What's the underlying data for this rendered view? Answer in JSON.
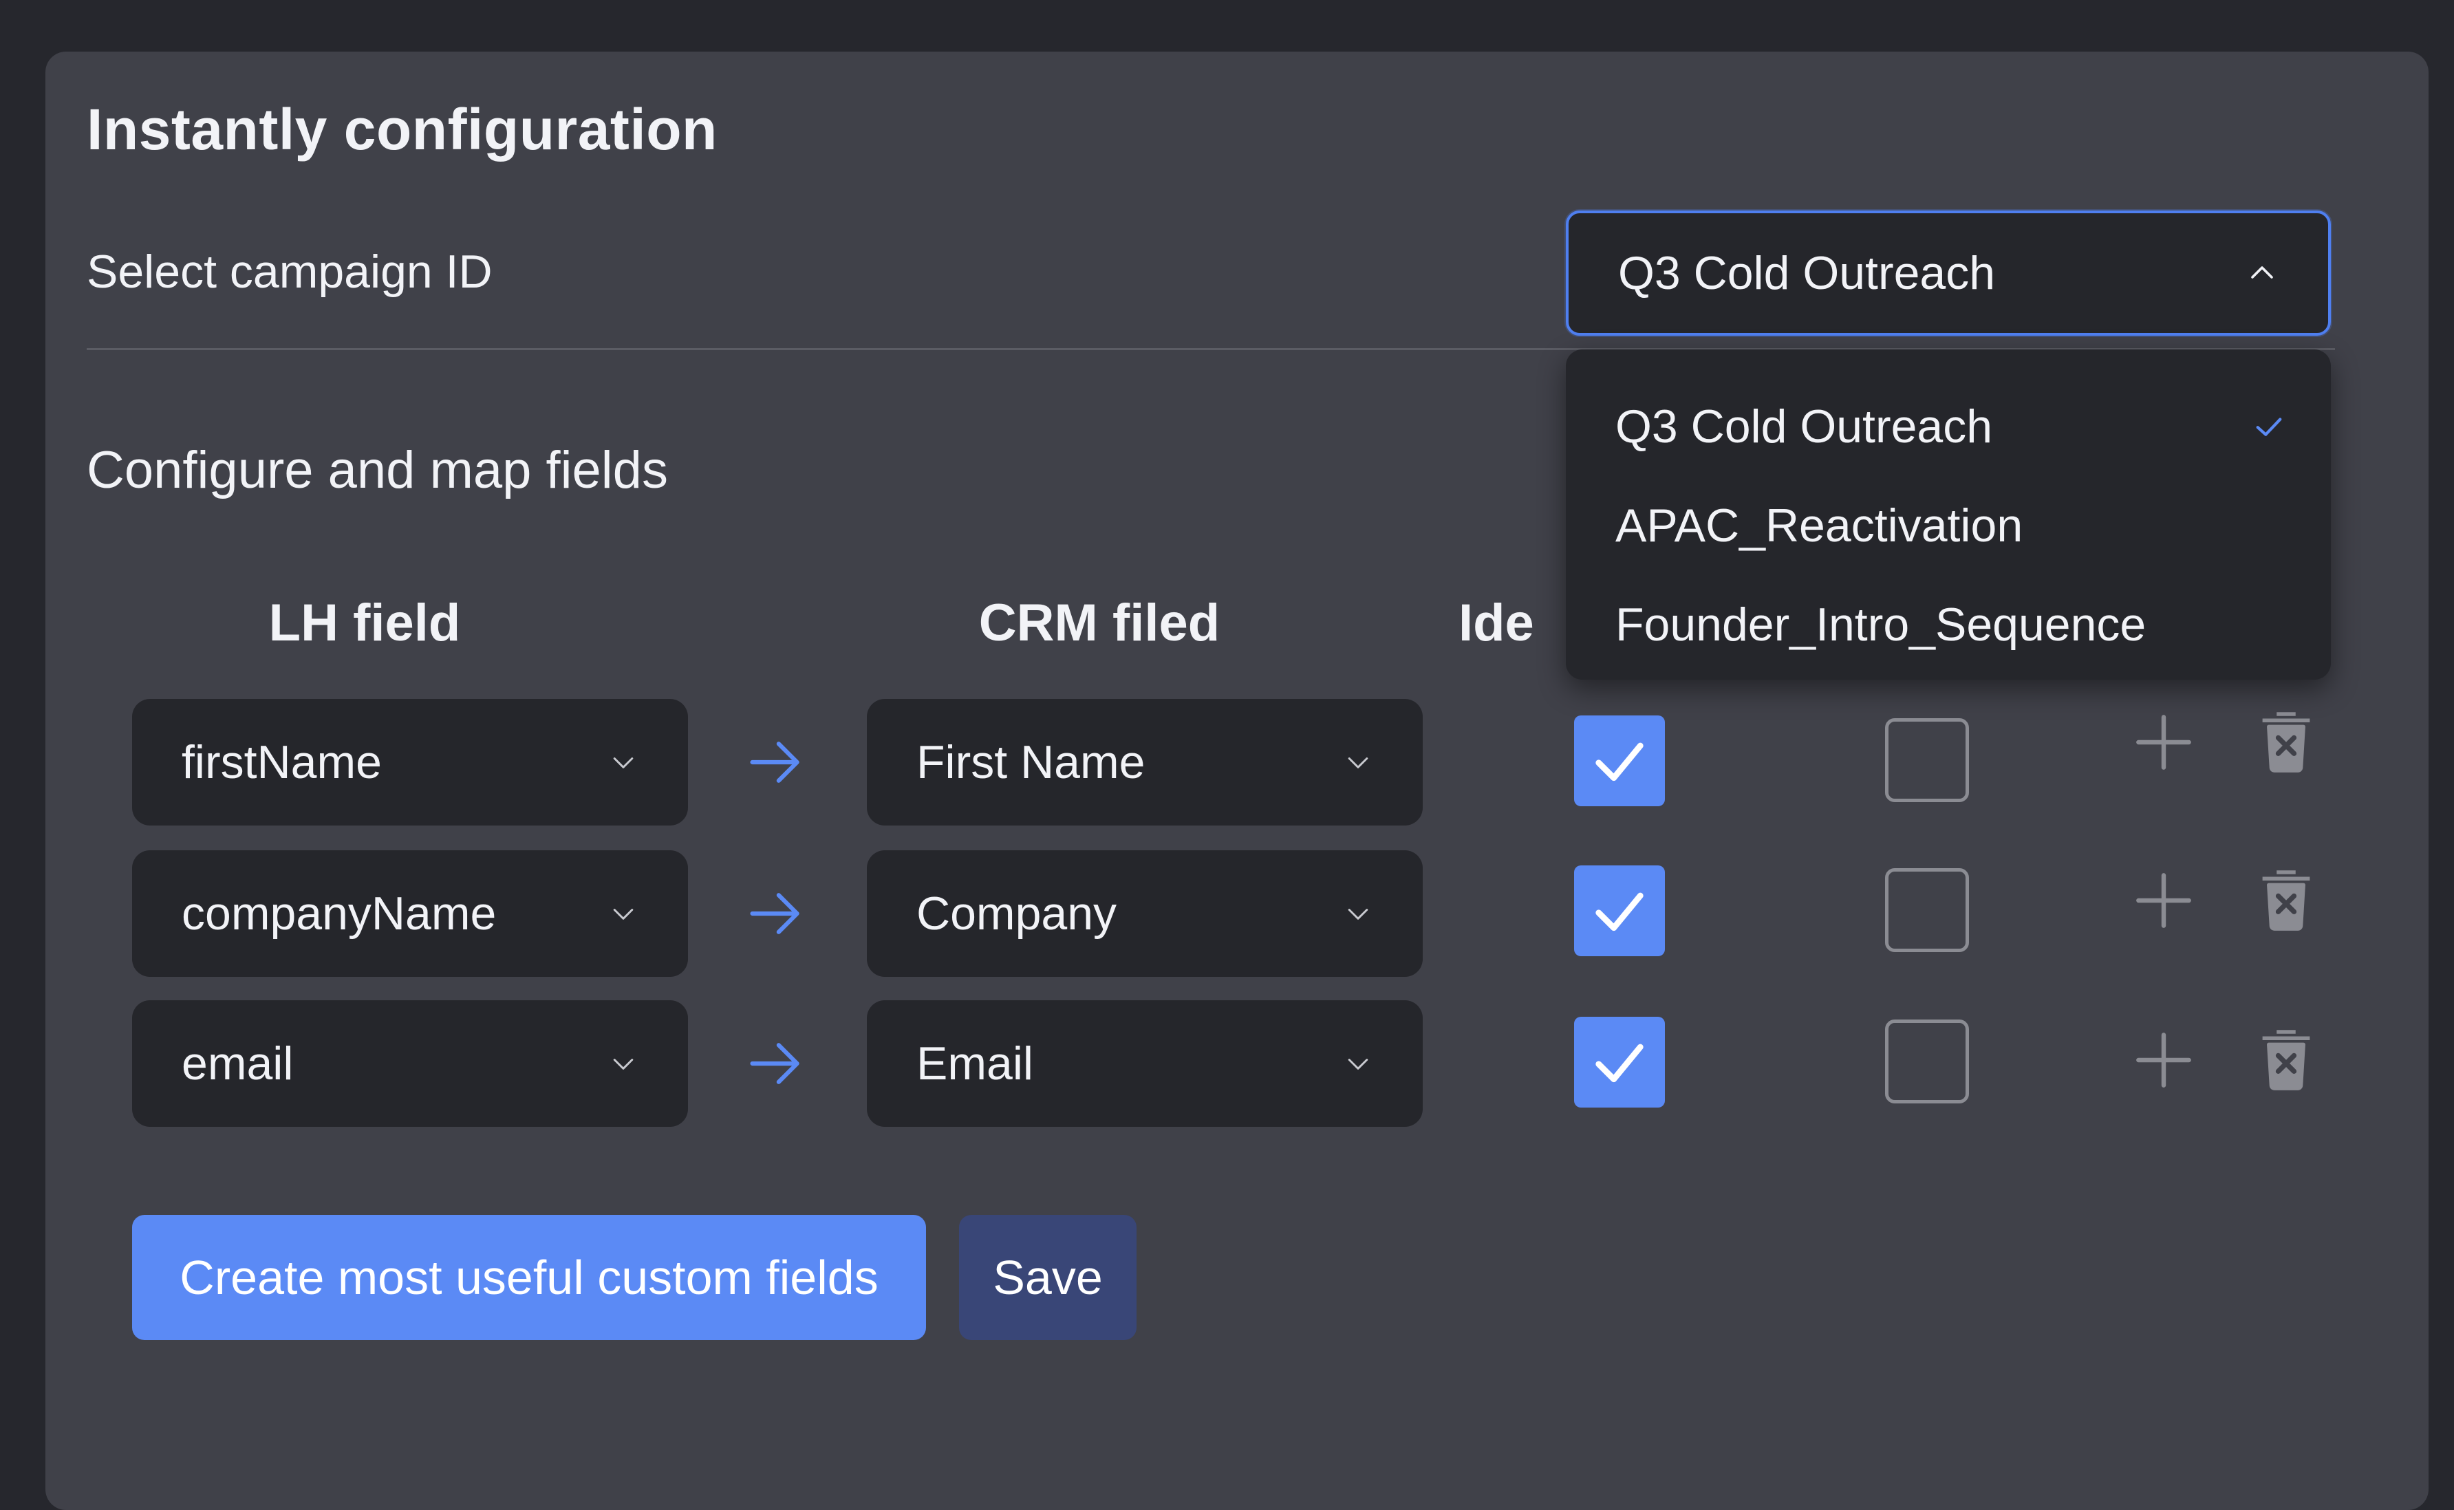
{
  "header": {
    "title": "Instantly configuration"
  },
  "campaign": {
    "label": "Select campaign ID",
    "selected": "Q3 Cold Outreach",
    "options": [
      {
        "label": "Q3 Cold Outreach",
        "selected": true
      },
      {
        "label": "APAC_Reactivation",
        "selected": false
      },
      {
        "label": "Founder_Intro_Sequence",
        "selected": false
      }
    ]
  },
  "mapping": {
    "title": "Configure and map fields",
    "columns": {
      "lh": "LH field",
      "crm": "CRM filed",
      "ide": "Ide"
    },
    "rows": [
      {
        "lh": "firstName",
        "crm": "First Name",
        "identifier": true,
        "second": false
      },
      {
        "lh": "companyName",
        "crm": "Company",
        "identifier": true,
        "second": false
      },
      {
        "lh": "email",
        "crm": "Email",
        "identifier": true,
        "second": false
      }
    ]
  },
  "actions": {
    "create_label": "Create most useful custom fields",
    "save_label": "Save"
  },
  "colors": {
    "accent": "#5b8af5",
    "panel": "#404149",
    "field": "#25262b",
    "save": "#394677"
  }
}
